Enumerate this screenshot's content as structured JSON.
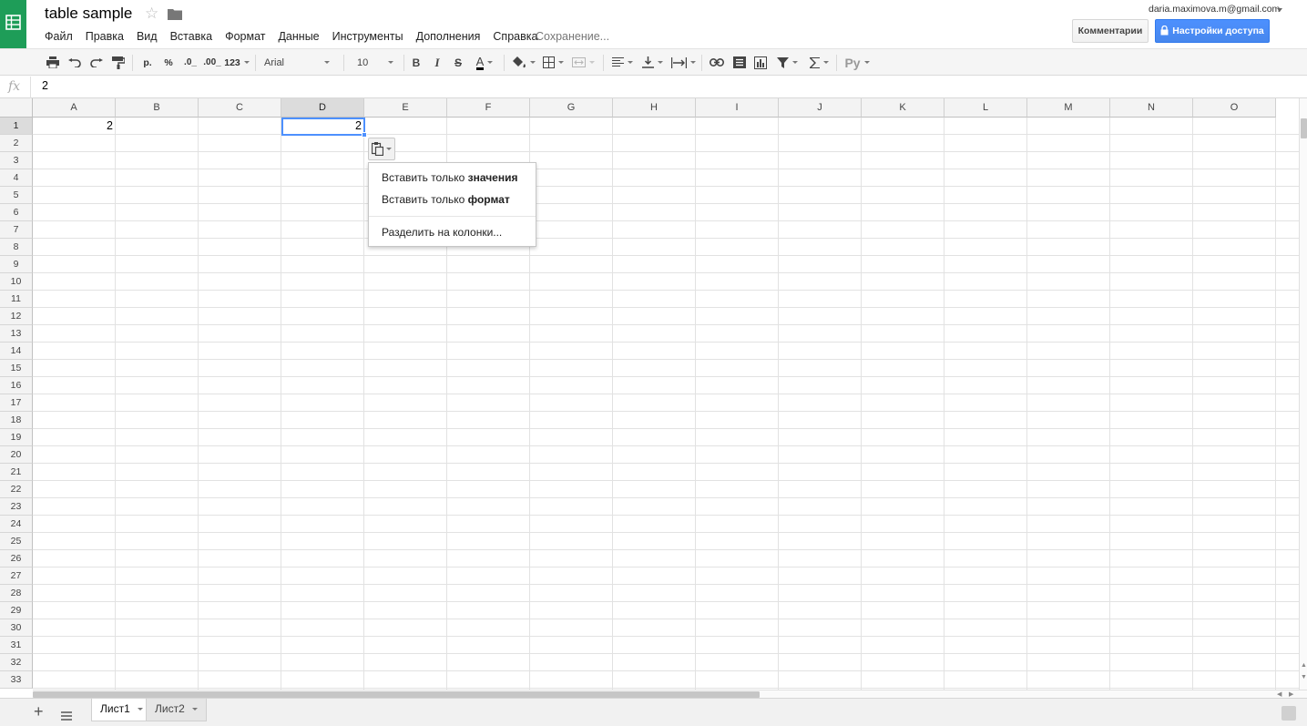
{
  "app": {
    "title": "table sample",
    "saving_status": "Сохранение...",
    "account": "daria.maximova.m@gmail.com",
    "colors": {
      "logo": "#1e9d58",
      "share_button": "#4d90fe",
      "selection": "#4d90fe"
    }
  },
  "menu": [
    "Файл",
    "Правка",
    "Вид",
    "Вставка",
    "Формат",
    "Данные",
    "Инструменты",
    "Дополнения",
    "Справка"
  ],
  "header_buttons": {
    "comments": "Комментарии",
    "share": "Настройки доступа"
  },
  "toolbar": {
    "currency": "р.",
    "percent": "%",
    "decrease_decimals": ".0_",
    "increase_decimals": ".00_",
    "more_formats": "123",
    "font": "Arial",
    "font_size": "10",
    "bold": "B",
    "italic": "I",
    "strikethrough": "S",
    "text_color": "A",
    "input_tools": "Ру",
    "icons": [
      "print-icon",
      "undo-icon",
      "redo-icon",
      "paint-format-icon",
      "fill-color-icon",
      "borders-icon",
      "merge-cells-icon",
      "align-left-icon",
      "valign-bottom-icon",
      "text-wrap-icon",
      "link-icon",
      "comment-icon",
      "chart-icon",
      "filter-icon",
      "sigma-icon"
    ]
  },
  "formula_bar": {
    "fx": "fx",
    "value": "2"
  },
  "grid": {
    "columns": [
      "A",
      "B",
      "C",
      "D",
      "E",
      "F",
      "G",
      "H",
      "I",
      "J",
      "K",
      "L",
      "M",
      "N",
      "O"
    ],
    "rows": [
      "1",
      "2",
      "3",
      "4",
      "5",
      "6",
      "7",
      "8",
      "9",
      "10",
      "11",
      "12",
      "13",
      "14",
      "15",
      "16",
      "17",
      "18",
      "19",
      "20",
      "21",
      "22",
      "23",
      "24",
      "25",
      "26",
      "27",
      "28",
      "29",
      "30",
      "31",
      "32",
      "33"
    ],
    "selected_column": "D",
    "selected_row": "1",
    "cells": [
      {
        "ref": "A1",
        "value": "2"
      },
      {
        "ref": "D1",
        "value": "2"
      }
    ]
  },
  "paste_menu": {
    "icon": "clipboard-icon",
    "values": {
      "prefix": "Вставить только ",
      "bold": "значения"
    },
    "format": {
      "prefix": "Вставить только ",
      "bold": "формат"
    },
    "split": "Разделить на колонки..."
  },
  "sheets": [
    {
      "name": "Лист1",
      "active": true
    },
    {
      "name": "Лист2",
      "active": false
    }
  ]
}
